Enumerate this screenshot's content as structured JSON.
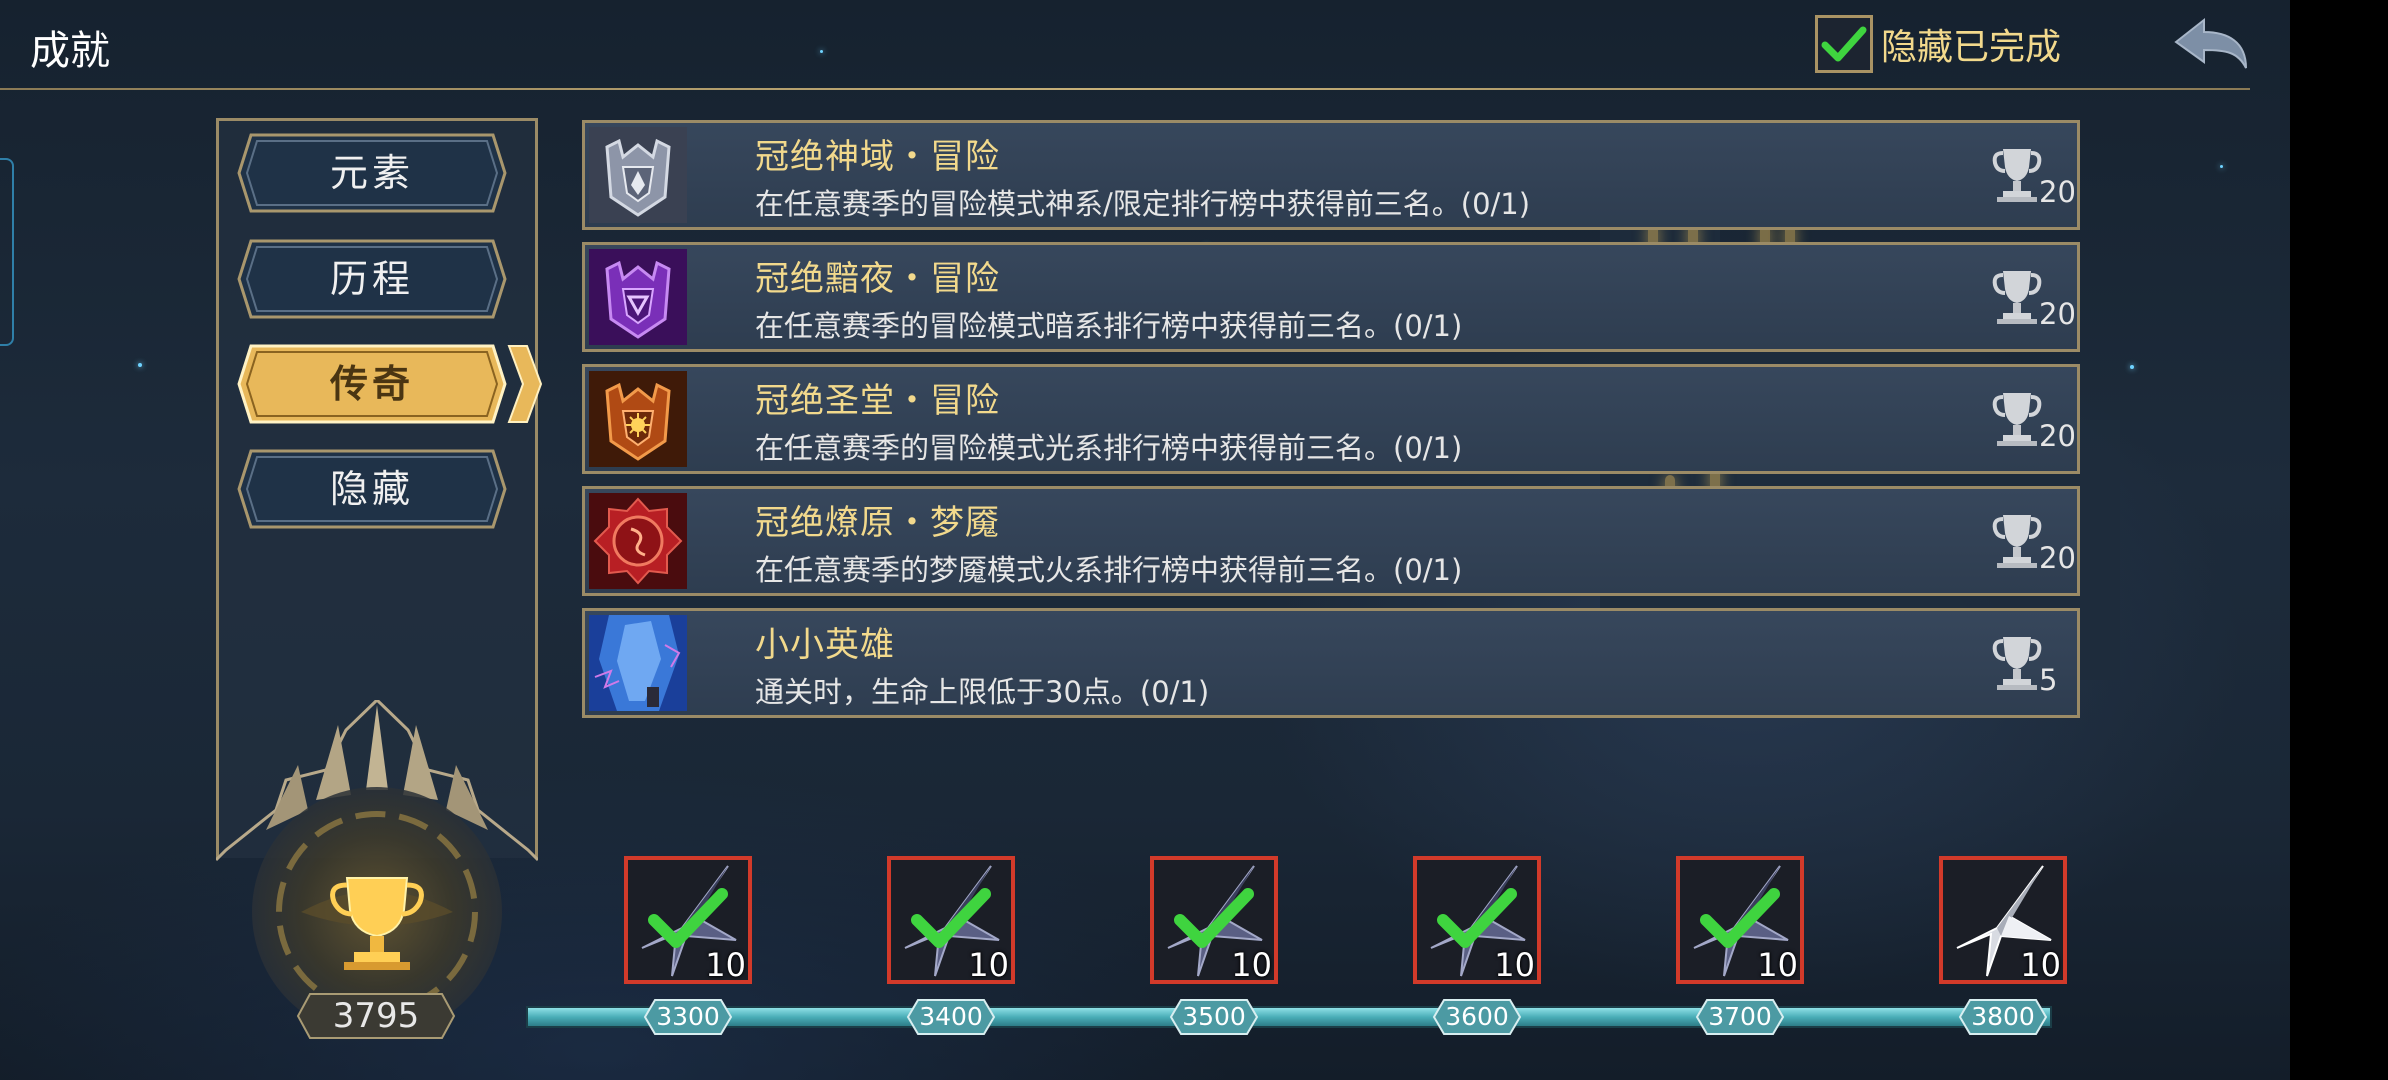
{
  "header": {
    "title": "成就",
    "hide_completed_label": "隐藏已完成",
    "hide_completed_checked": true,
    "back_icon": "back-arrow-icon"
  },
  "sidebar": {
    "tabs": [
      {
        "label": "元素",
        "active": false
      },
      {
        "label": "历程",
        "active": false
      },
      {
        "label": "传奇",
        "active": true
      },
      {
        "label": "隐藏",
        "active": false
      }
    ],
    "total_score": "3795",
    "trophy_icon": "gold-trophy-icon"
  },
  "achievements": [
    {
      "title": "冠绝神域・冒险",
      "desc": "在任意赛季的冒险模式神系/限定排行榜中获得前三名。(0/1)",
      "points": "20",
      "icon": "silver-crest-icon",
      "icon_color": "#9aa3b5"
    },
    {
      "title": "冠绝黯夜・冒险",
      "desc": "在任意赛季的冒险模式暗系排行榜中获得前三名。(0/1)",
      "points": "20",
      "icon": "purple-crest-icon",
      "icon_color": "#8a3fc9"
    },
    {
      "title": "冠绝圣堂・冒险",
      "desc": "在任意赛季的冒险模式光系排行榜中获得前三名。(0/1)",
      "points": "20",
      "icon": "orange-crest-icon",
      "icon_color": "#d8641c"
    },
    {
      "title": "冠绝燎原・梦魇",
      "desc": "在任意赛季的梦魇模式火系排行榜中获得前三名。(0/1)",
      "points": "20",
      "icon": "red-seal-icon",
      "icon_color": "#c7262a"
    },
    {
      "title": "小小英雄",
      "desc": "通关时，生命上限低于30点。(0/1)",
      "points": "5",
      "icon": "blue-crystal-hero-icon",
      "icon_color": "#3a78d8"
    }
  ],
  "rewards": [
    {
      "milestone": "3300",
      "qty": "10",
      "claimed": true,
      "icon": "dark-star-shard-icon"
    },
    {
      "milestone": "3400",
      "qty": "10",
      "claimed": true,
      "icon": "dark-star-shard-icon"
    },
    {
      "milestone": "3500",
      "qty": "10",
      "claimed": true,
      "icon": "dark-star-shard-icon"
    },
    {
      "milestone": "3600",
      "qty": "10",
      "claimed": true,
      "icon": "dark-star-shard-icon"
    },
    {
      "milestone": "3700",
      "qty": "10",
      "claimed": true,
      "icon": "dark-star-shard-icon"
    },
    {
      "milestone": "3800",
      "qty": "10",
      "claimed": false,
      "icon": "silver-star-shard-icon"
    }
  ],
  "colors": {
    "gold_text": "#f2d98c",
    "frame_gold": "#9b8b66",
    "active_tab": "#e8b85a",
    "check_green": "#3fd43f",
    "reward_border": "#d23a2a",
    "progress_teal": "#4aaeb8"
  }
}
